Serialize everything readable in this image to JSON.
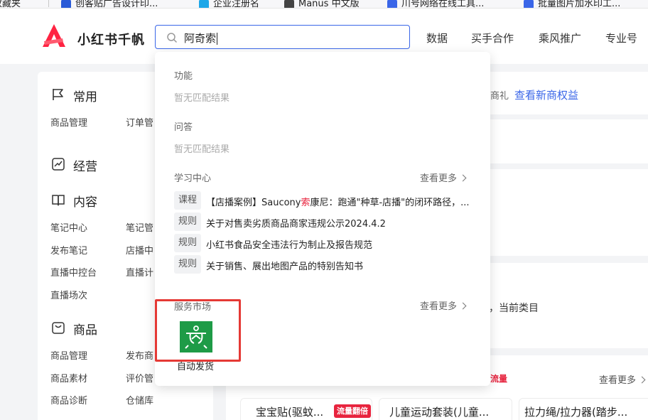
{
  "bookmarks": [
    {
      "label": "收藏夹",
      "color": "#f5b400"
    },
    {
      "label": "创客贴广告设计印...",
      "color": "#2a5bd7"
    },
    {
      "label": "企业注册名",
      "color": "#1ea7e8"
    },
    {
      "label": "Manus 中文版",
      "color": "#444444"
    },
    {
      "label": "川号网络在线工具...",
      "color": "#3a66e8"
    },
    {
      "label": "批量图片加水印工...",
      "color": "#3a66e8"
    }
  ],
  "header": {
    "brand": "小红书千帆",
    "brand_color": "#ff2442",
    "search_value": "阿奇索",
    "nav": [
      "数据",
      "买手合作",
      "乘风推广",
      "专业号"
    ]
  },
  "sidebar": {
    "sections": [
      {
        "title": "常用",
        "icon": "flag-icon",
        "items": [
          "商品管理",
          "订单管"
        ]
      },
      {
        "title": "经营",
        "icon": "trend-chart-icon",
        "items": []
      },
      {
        "title": "内容",
        "icon": "book-icon",
        "items": [
          "笔记中心",
          "笔记管",
          "发布笔记",
          "店播中",
          "直播中控台",
          "直播计",
          "直播场次"
        ]
      },
      {
        "title": "商品",
        "icon": "bag-icon",
        "items": [
          "商品管理",
          "发布商",
          "商品素材",
          "评价管",
          "商品诊断",
          "仓储库"
        ]
      }
    ]
  },
  "main": {
    "promo_prefix": "商礼",
    "promo_link": "查看新商权益",
    "current_prefix": "，",
    "current_category": "当前类目",
    "flow_prefix": "流量",
    "see_more": "查看更多",
    "products": [
      {
        "name": "宝宝贴(驱蚊...",
        "badge": "流量翻倍"
      },
      {
        "name": "儿童运动套装(儿童..."
      },
      {
        "name": "拉力绳/拉力器(踏步..."
      }
    ]
  },
  "dropdown": {
    "groups": {
      "function": {
        "label": "功能",
        "empty": "暂无匹配结果"
      },
      "qa": {
        "label": "问答",
        "empty": "暂无匹配结果"
      },
      "learning": {
        "label": "学习中心",
        "more": "查看更多",
        "items": [
          {
            "tag": "课程",
            "pre": "【店播案例】Saucony",
            "highlight": "索",
            "post": "康尼：跑通\"种草-店播\"的闭环路径，..."
          },
          {
            "tag": "规则",
            "pre": "关于对售卖劣质商品商家违规公示2024.4.2",
            "highlight": "",
            "post": ""
          },
          {
            "tag": "规则",
            "pre": "小红书食品安全违法行为制止及报告规范",
            "highlight": "",
            "post": ""
          },
          {
            "tag": "规则",
            "pre": "关于销售、展出地图产品的特别告知书",
            "highlight": "",
            "post": ""
          }
        ]
      },
      "service": {
        "label": "服务市场",
        "more": "查看更多",
        "app_name": "自动发货",
        "app_icon": "auto-delivery-icon",
        "app_color": "#1e9b47",
        "highlight_color": "#e53935"
      }
    }
  }
}
